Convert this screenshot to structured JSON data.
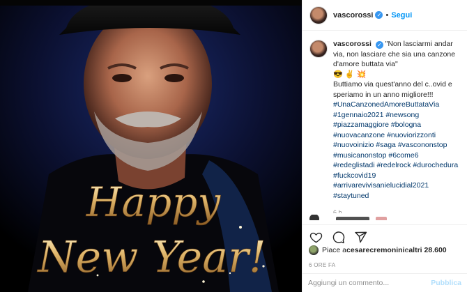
{
  "post": {
    "username": "vascorossi",
    "follow_label": "Segui",
    "dot": "•",
    "caption_quote": "\"Non lasciarmi andar via, non lasciare che sia una canzone d'amore buttata via\"",
    "caption_emojis": "😎 ✌️ 💥",
    "caption_body": "Buttiamo via quest'anno del c..ovid e speriamo in un anno migliore!!!",
    "hashtag_lines": [
      "#UnaCanzonedAmoreButtataVia",
      "#1gennaio2021 #newsong",
      "#piazzamaggiore #bologna",
      "#nuovacanzone #nuoviorizzonti",
      "#nuovoinizio #saga #vascononstop",
      "#musicanonstop #6come6",
      "#redeglistadi #redelrock #durochedura",
      "#fuckcovid19",
      "#arrivarevivisanielucidial2021",
      "#staytuned"
    ],
    "caption_time": "6 h",
    "likes_prefix": "Piace a ",
    "likes_user": "cesarecremonini",
    "likes_mid": " e ",
    "likes_count": "altri 28.600",
    "posted_ago": "6 ORE FA",
    "comment_placeholder": "Aggiungi un commento...",
    "publish_label": "Pubblica"
  },
  "image": {
    "line1": "Happy",
    "line2": "New Year!"
  },
  "icons": {
    "like": "heart-icon",
    "comment": "comment-icon",
    "share": "share-icon",
    "verified": "verified-badge-icon"
  },
  "colors": {
    "link_blue": "#0095f6",
    "hashtag": "#00376b",
    "muted": "#8e8e8e",
    "verified": "#3897f0"
  }
}
